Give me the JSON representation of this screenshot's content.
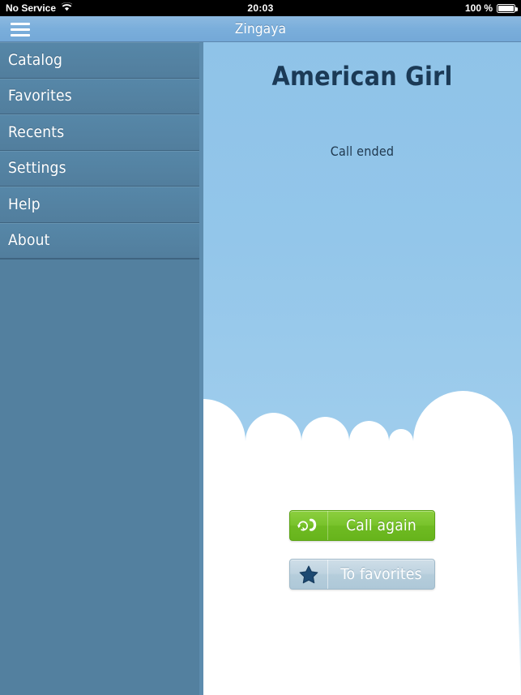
{
  "statusbar": {
    "carrier": "No Service",
    "wifi_icon": "wifi-icon",
    "time": "20:03",
    "battery_percent": "100 %",
    "battery_icon": "battery-full-icon"
  },
  "navbar": {
    "menu_icon": "hamburger-menu-icon",
    "title": "Zingaya"
  },
  "sidebar": {
    "items": [
      {
        "label": "Catalog"
      },
      {
        "label": "Favorites"
      },
      {
        "label": "Recents"
      },
      {
        "label": "Settings"
      },
      {
        "label": "Help"
      },
      {
        "label": "About"
      }
    ]
  },
  "content": {
    "callee_name": "American Girl",
    "call_status": "Call ended",
    "buttons": [
      {
        "label": "Call again",
        "icon": "redial-phone-icon",
        "color": "#73bf28"
      },
      {
        "label": "To favorites",
        "icon": "star-icon",
        "color": "#b9d0de"
      }
    ]
  },
  "colors": {
    "navbar": "#7aaedb",
    "sidebar": "#53809f",
    "sky_top": "#8fc3e8",
    "cloud": "#ffffff",
    "title_text": "#1b3a56",
    "call_button": "#73bf28",
    "favorites_button": "#b9d0de",
    "star": "#1d4a72"
  }
}
